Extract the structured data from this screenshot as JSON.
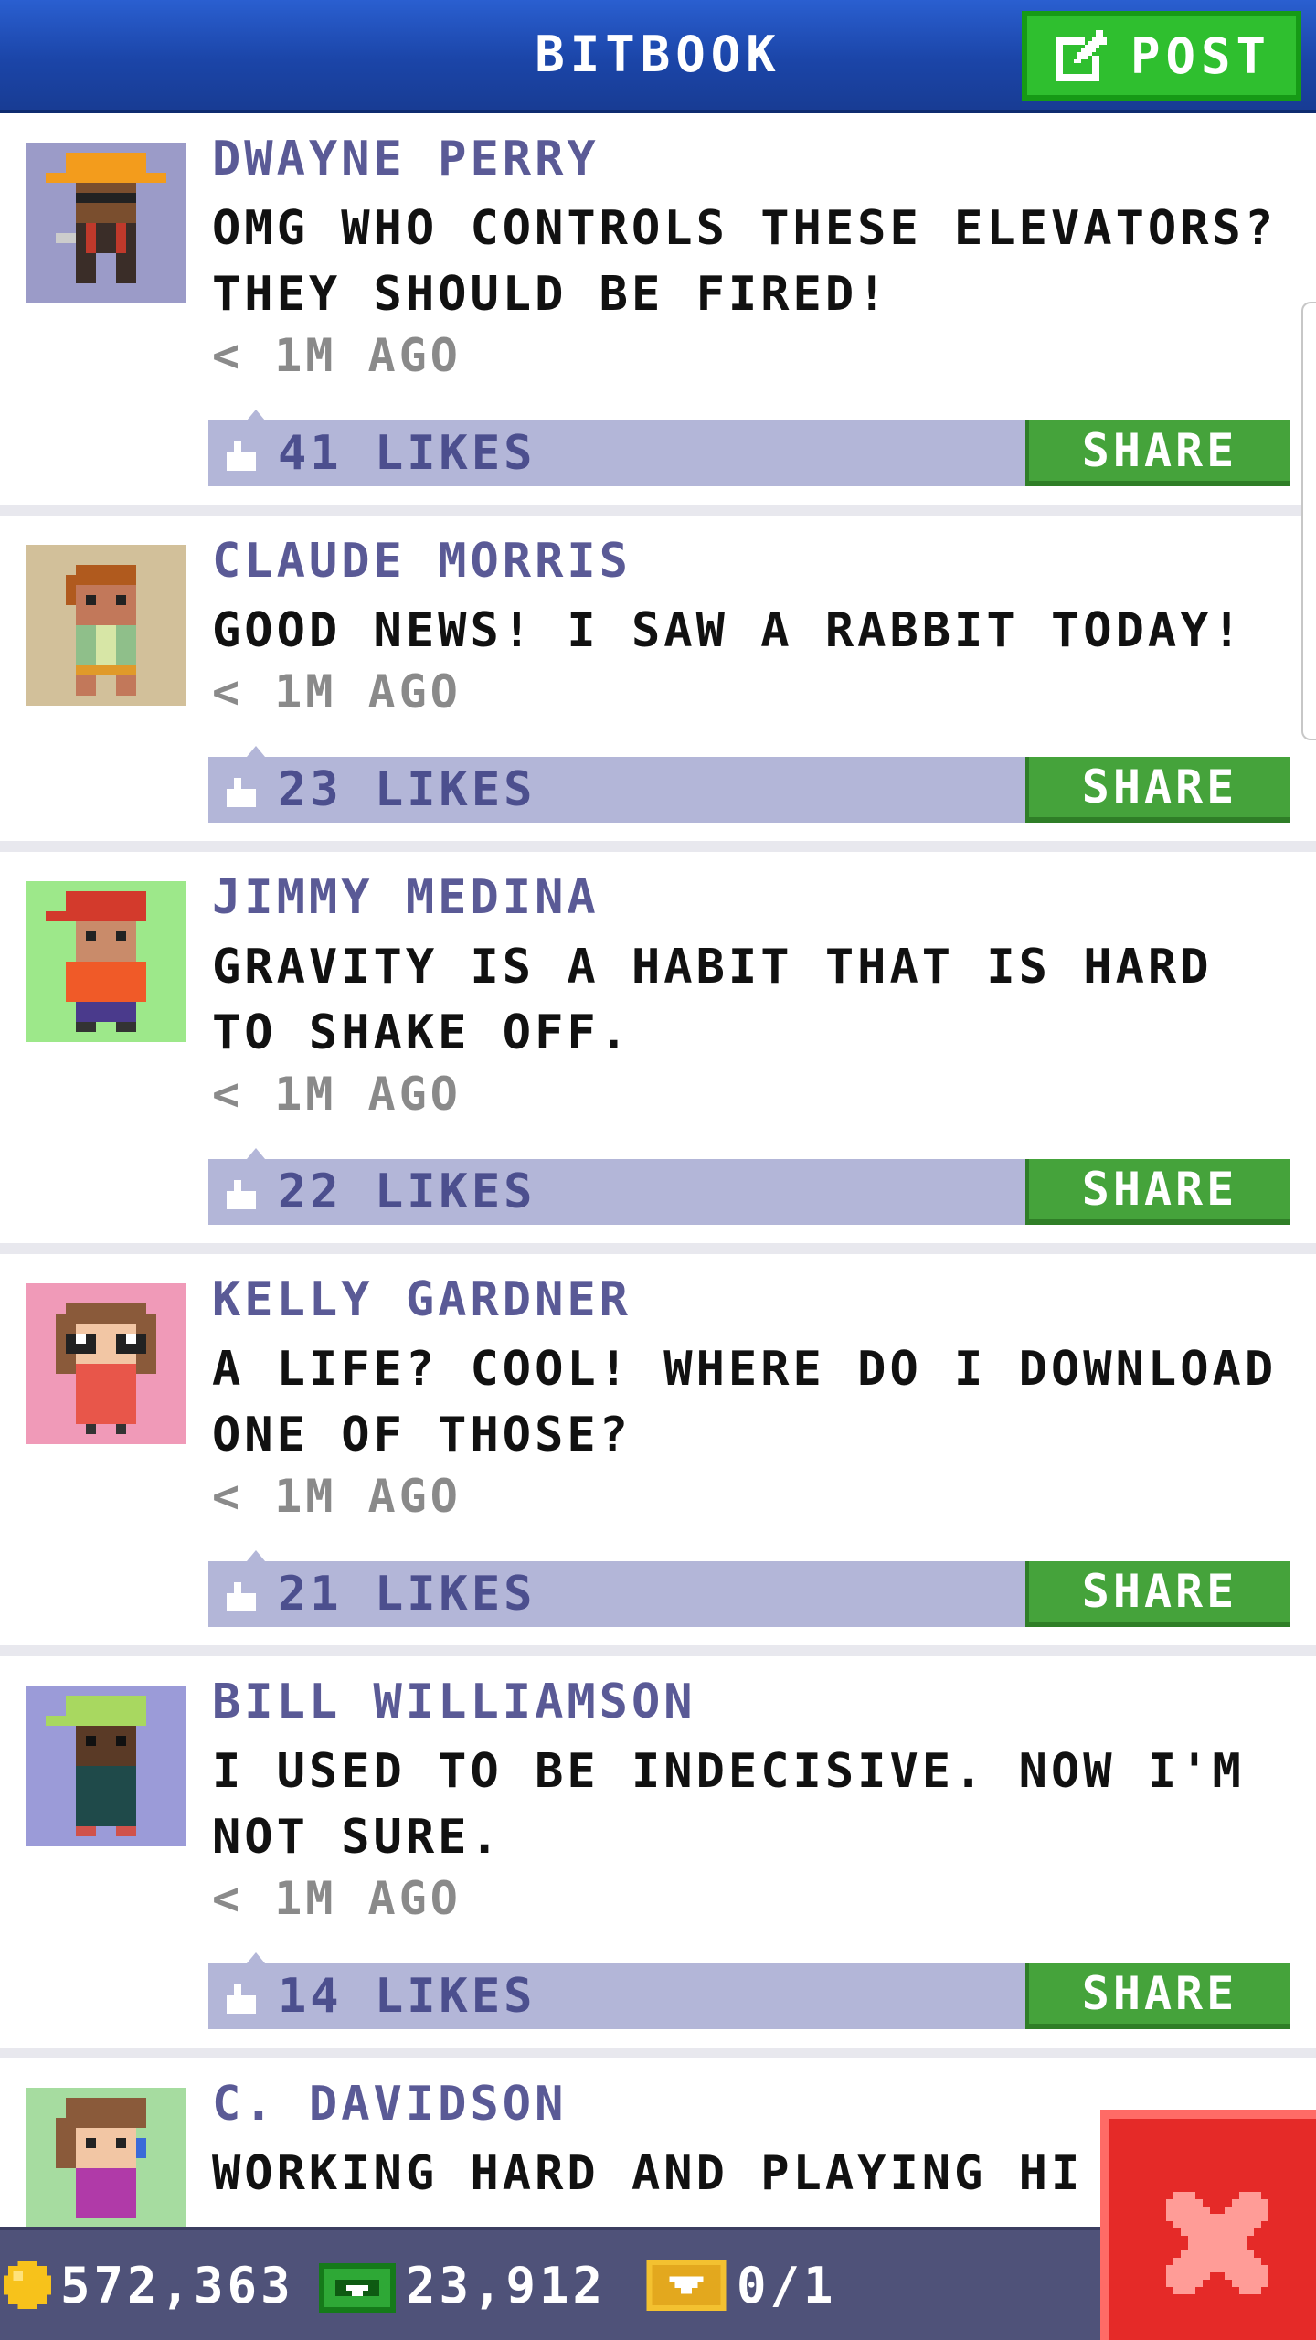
{
  "header": {
    "title": "BITBOOK",
    "post_label": "POST"
  },
  "posts": [
    {
      "author": "DWAYNE PERRY",
      "message": "OMG WHO CONTROLS THESE ELEVATORS? THEY SHOULD BE FIRED!",
      "time": "< 1M AGO",
      "likes": "41 LIKES",
      "share_label": "SHARE",
      "avatar_bg": "#9b9bc8"
    },
    {
      "author": "CLAUDE MORRIS",
      "message": "GOOD NEWS! I SAW A RABBIT TODAY!",
      "time": "< 1M AGO",
      "likes": "23 LIKES",
      "share_label": "SHARE",
      "avatar_bg": "#d2c09a"
    },
    {
      "author": "JIMMY MEDINA",
      "message": "GRAVITY IS A HABIT THAT IS HARD TO SHAKE OFF.",
      "time": "< 1M AGO",
      "likes": "22 LIKES",
      "share_label": "SHARE",
      "avatar_bg": "#9de88a"
    },
    {
      "author": "KELLY GARDNER",
      "message": "A LIFE? COOL! WHERE DO I DOWNLOAD ONE OF THOSE?",
      "time": "< 1M AGO",
      "likes": "21 LIKES",
      "share_label": "SHARE",
      "avatar_bg": "#f09ab8"
    },
    {
      "author": "BILL WILLIAMSON",
      "message": "I USED TO BE INDECISIVE. NOW I'M NOT SURE.",
      "time": "< 1M AGO",
      "likes": "14 LIKES",
      "share_label": "SHARE",
      "avatar_bg": "#9b9bd8"
    },
    {
      "author": "C. DAVIDSON",
      "message": "WORKING HARD AND PLAYING HI",
      "avatar_bg": "#a6dca0"
    }
  ],
  "status": {
    "coins": "572,363",
    "bux": "23,912",
    "tickets": "0/1"
  },
  "colors": {
    "header": "#1b45a8",
    "post_button": "#2fbf2f",
    "share_button": "#45a33b",
    "like_bar": "#b3b6d8",
    "author_text": "#5a5a96",
    "status_bar": "#4f5279",
    "close_button": "#e52a28"
  },
  "icons": {
    "post": "edit-icon",
    "like": "thumbs-up-icon",
    "coin": "coin-icon",
    "bux": "bux-icon",
    "ticket": "ticket-icon",
    "close": "close-icon"
  }
}
